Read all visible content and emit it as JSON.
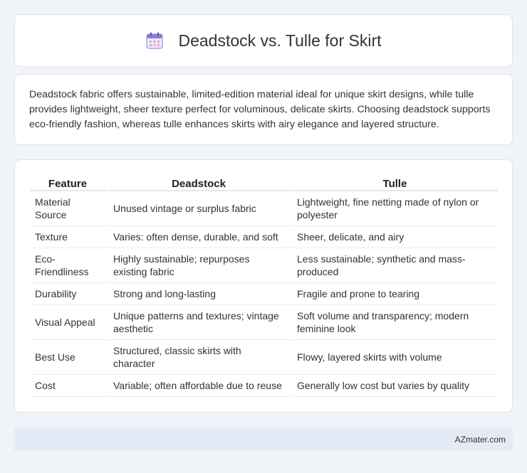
{
  "header": {
    "title": "Deadstock vs. Tulle for Skirt",
    "icon": "calendar-icon"
  },
  "description": "Deadstock fabric offers sustainable, limited-edition material ideal for unique skirt designs, while tulle provides lightweight, sheer texture perfect for voluminous, delicate skirts. Choosing deadstock supports eco-friendly fashion, whereas tulle enhances skirts with airy elegance and layered structure.",
  "table": {
    "columns": [
      "Feature",
      "Deadstock",
      "Tulle"
    ],
    "rows": [
      [
        "Material Source",
        "Unused vintage or surplus fabric",
        "Lightweight, fine netting made of nylon or polyester"
      ],
      [
        "Texture",
        "Varies: often dense, durable, and soft",
        "Sheer, delicate, and airy"
      ],
      [
        "Eco-Friendliness",
        "Highly sustainable; repurposes existing fabric",
        "Less sustainable; synthetic and mass-produced"
      ],
      [
        "Durability",
        "Strong and long-lasting",
        "Fragile and prone to tearing"
      ],
      [
        "Visual Appeal",
        "Unique patterns and textures; vintage aesthetic",
        "Soft volume and transparency; modern feminine look"
      ],
      [
        "Best Use",
        "Structured, classic skirts with character",
        "Flowy, layered skirts with volume"
      ],
      [
        "Cost",
        "Variable; often affordable due to reuse",
        "Generally low cost but varies by quality"
      ]
    ]
  },
  "footer": {
    "source": "AZmater.com"
  },
  "colors": {
    "background": "#f0f3f8",
    "card": "#ffffff",
    "footer": "#e4ebf6",
    "icon_accent": "#8a7fd4"
  }
}
